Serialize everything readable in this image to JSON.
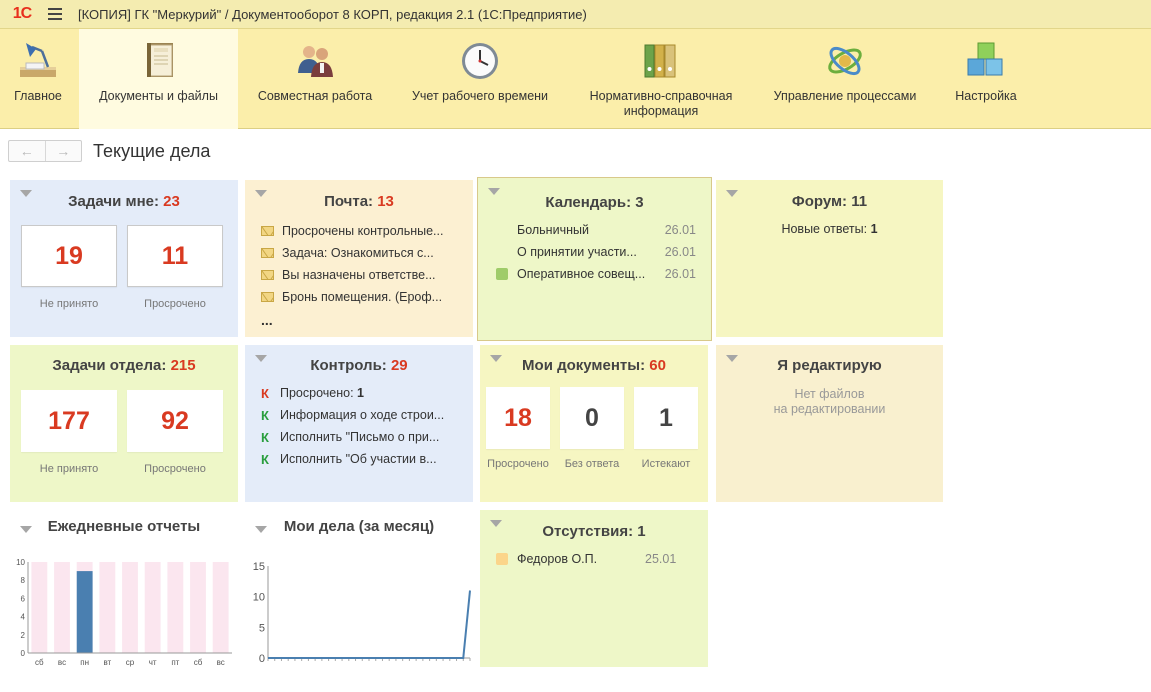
{
  "window": {
    "logo": "1С",
    "title": "[КОПИЯ] ГК \"Меркурий\" / Документооборот 8 КОРП, редакция 2.1  (1С:Предприятие)"
  },
  "sections": [
    {
      "label": "Главное",
      "icon": "desk-lamp-icon",
      "active": false
    },
    {
      "label": "Документы и файлы",
      "icon": "documents-binder-icon",
      "active": true
    },
    {
      "label": "Совместная работа",
      "icon": "people-icon",
      "active": false
    },
    {
      "label": "Учет рабочего времени",
      "icon": "clock-icon",
      "active": false
    },
    {
      "label": "Нормативно-справочная информация",
      "icon": "folders-icon",
      "active": false
    },
    {
      "label": "Управление процессами",
      "icon": "process-gear-icon",
      "active": false
    },
    {
      "label": "Настройка",
      "icon": "cubes-icon",
      "active": false
    }
  ],
  "nav": {
    "back": "←",
    "forward": "→",
    "page_title": "Текущие дела"
  },
  "colors": {
    "accent_red": "#d93a21",
    "bar": "#4a7fb0",
    "bar_bg": "#fbe6ef",
    "line": "#4a7fb0"
  },
  "tasks_me": {
    "title": "Задачи мне:",
    "count": "23",
    "not_accepted": "19",
    "not_accepted_label": "Не принято",
    "overdue": "11",
    "overdue_label": "Просрочено"
  },
  "mail": {
    "title": "Почта:",
    "count": "13",
    "items": [
      "Просрочены контрольные...",
      "Задача: Ознакомиться с...",
      "Вы назначены ответстве...",
      "Бронь помещения. (Ероф..."
    ],
    "more": "..."
  },
  "calendar": {
    "title": "Календарь:",
    "count": "3",
    "items": [
      {
        "text": "Больничный",
        "date": "26.01",
        "color": ""
      },
      {
        "text": "О принятии участи...",
        "date": "26.01",
        "color": ""
      },
      {
        "text": "Оперативное совещ...",
        "date": "26.01",
        "color": "#9fcc6a"
      }
    ]
  },
  "forum": {
    "title": "Форум:",
    "count": "11",
    "new_label": "Новые ответы:",
    "new_count": "1"
  },
  "tasks_dept": {
    "title": "Задачи отдела:",
    "count": "215",
    "not_accepted": "177",
    "not_accepted_label": "Не принято",
    "overdue": "92",
    "overdue_label": "Просрочено"
  },
  "control": {
    "title": "Контроль:",
    "count": "29",
    "items": [
      {
        "mark": "К",
        "color": "red",
        "text": "Просрочено:",
        "bold": "1"
      },
      {
        "mark": "К",
        "color": "green",
        "text": "Информация о ходе строи...",
        "bold": ""
      },
      {
        "mark": "К",
        "color": "green",
        "text": "Исполнить \"Письмо о при...",
        "bold": ""
      },
      {
        "mark": "К",
        "color": "green",
        "text": "Исполнить \"Об участии в...",
        "bold": ""
      }
    ]
  },
  "my_docs": {
    "title": "Мои документы:",
    "count": "60",
    "overdue": "18",
    "overdue_label": "Просрочено",
    "no_answer": "0",
    "no_answer_label": "Без ответа",
    "expiring": "1",
    "expiring_label": "Истекают"
  },
  "editing": {
    "title": "Я редактирую",
    "line1": "Нет файлов",
    "line2": "на редактировании"
  },
  "absences": {
    "title": "Отсутствия:",
    "count": "1",
    "items": [
      {
        "text": "Федоров О.П.",
        "date": "25.01",
        "color": "#fbd58a"
      }
    ]
  },
  "chart_data": [
    {
      "type": "bar",
      "title": "Ежедневные отчеты",
      "categories": [
        "сб",
        "вс",
        "пн",
        "вт",
        "ср",
        "чт",
        "пт",
        "сб",
        "вс"
      ],
      "values": [
        0,
        0,
        9,
        0,
        0,
        0,
        0,
        0,
        0
      ],
      "yticks": [
        0,
        2,
        4,
        6,
        8,
        10
      ],
      "ylim": [
        0,
        10
      ]
    },
    {
      "type": "line",
      "title": "Мои дела (за месяц)",
      "x": [
        0,
        1,
        2,
        3,
        4,
        5,
        6,
        7,
        8,
        9,
        10,
        11,
        12,
        13,
        14,
        15,
        16,
        17,
        18,
        19,
        20,
        21,
        22,
        23,
        24,
        25,
        26,
        27,
        28,
        29,
        30
      ],
      "values": [
        0,
        0,
        0,
        0,
        0,
        0,
        0,
        0,
        0,
        0,
        0,
        0,
        0,
        0,
        0,
        0,
        0,
        0,
        0,
        0,
        0,
        0,
        0,
        0,
        0,
        0,
        0,
        0,
        0,
        0,
        11
      ],
      "yticks": [
        0,
        5,
        10,
        15
      ],
      "ylim": [
        0,
        15
      ]
    }
  ]
}
